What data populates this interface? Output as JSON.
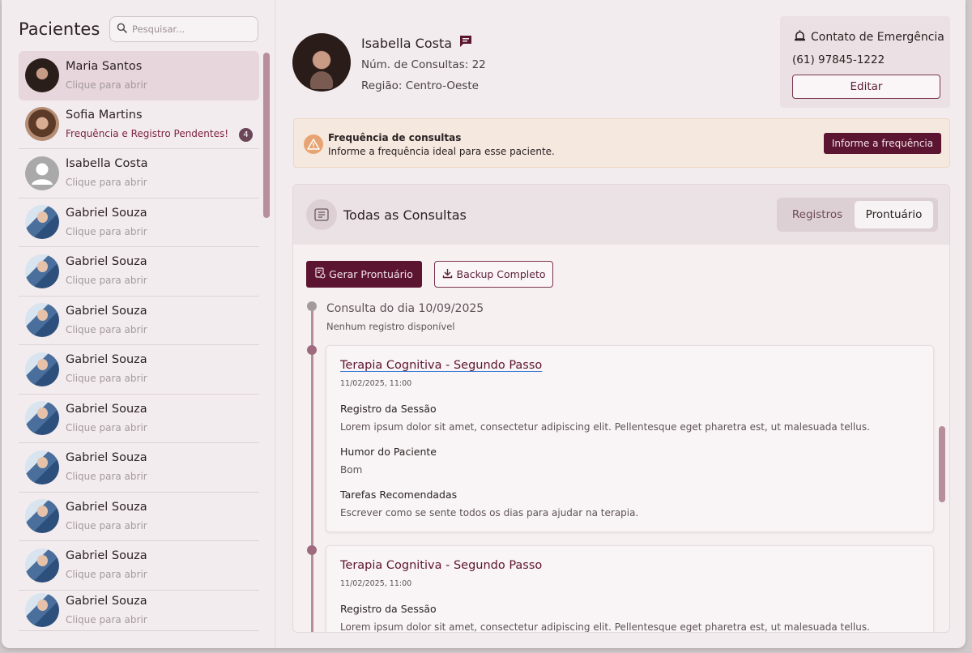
{
  "sidebar": {
    "title": "Pacientes",
    "search_placeholder": "Pesquisar...",
    "patients": [
      {
        "name": "Maria Santos",
        "subtitle": "Clique para abrir",
        "selected": true
      },
      {
        "name": "Sofia Martins",
        "subtitle": "Frequência e Registro Pendentes!",
        "badge": "4"
      },
      {
        "name": "Isabella Costa",
        "subtitle": "Clique para abrir"
      },
      {
        "name": "Gabriel Souza",
        "subtitle": "Clique para abrir"
      },
      {
        "name": "Gabriel Souza",
        "subtitle": "Clique para abrir"
      },
      {
        "name": "Gabriel Souza",
        "subtitle": "Clique para abrir"
      },
      {
        "name": "Gabriel Souza",
        "subtitle": "Clique para abrir"
      },
      {
        "name": "Gabriel Souza",
        "subtitle": "Clique para abrir"
      },
      {
        "name": "Gabriel Souza",
        "subtitle": "Clique para abrir"
      },
      {
        "name": "Gabriel Souza",
        "subtitle": "Clique para abrir"
      },
      {
        "name": "Gabriel Souza",
        "subtitle": "Clique para abrir"
      },
      {
        "name": "Gabriel Souza",
        "subtitle": "Clique para abrir"
      }
    ]
  },
  "profile": {
    "name": "Isabella Costa",
    "consultas": "Núm. de Consultas: 22",
    "regiao": "Região: Centro-Oeste"
  },
  "emergency": {
    "title": "Contato de Emergência",
    "phone": "(61) 97845-1222",
    "edit_label": "Editar"
  },
  "warning": {
    "title": "Frequência de consultas",
    "text": "Informe a frequência ideal para esse paciente.",
    "button_label": "Informe a frequência"
  },
  "consultas": {
    "title": "Todas as Consultas",
    "tabs": [
      {
        "label": "Registros",
        "active": false
      },
      {
        "label": "Prontuário",
        "active": true
      }
    ],
    "gerar_label": "Gerar Prontuário",
    "backup_label": "Backup Completo",
    "entry_date": "Consulta do dia 10/09/2025",
    "entry_empty": "Nenhum registro disponível",
    "cards": [
      {
        "title": "Terapia Cognitiva - Segundo Passo",
        "datetime": "11/02/2025, 11:00",
        "registro_label": "Registro da Sessão",
        "registro": "Lorem ipsum dolor sit amet, consectetur adipiscing elit. Pellentesque eget pharetra est, ut malesuada tellus.",
        "humor_label": "Humor do Paciente",
        "humor": "Bom",
        "tarefas_label": "Tarefas Recomendadas",
        "tarefas": "Escrever como se sente todos os dias para ajudar na terapia."
      },
      {
        "title": "Terapia Cognitiva - Segundo Passo",
        "datetime": "11/02/2025, 11:00",
        "registro_label": "Registro da Sessão",
        "registro": "Lorem ipsum dolor sit amet, consectetur adipiscing elit. Pellentesque eget pharetra est, ut malesuada tellus."
      }
    ]
  },
  "colors": {
    "accent": "#5c1530",
    "selected_row": "#e7d6dc",
    "warning_bg": "#f4e8df",
    "timeline": "#b88e9c"
  },
  "icons": [
    "search-icon",
    "message-icon",
    "alarm-bell-icon",
    "warning-icon",
    "document-list-icon",
    "file-report-icon",
    "download-icon"
  ]
}
